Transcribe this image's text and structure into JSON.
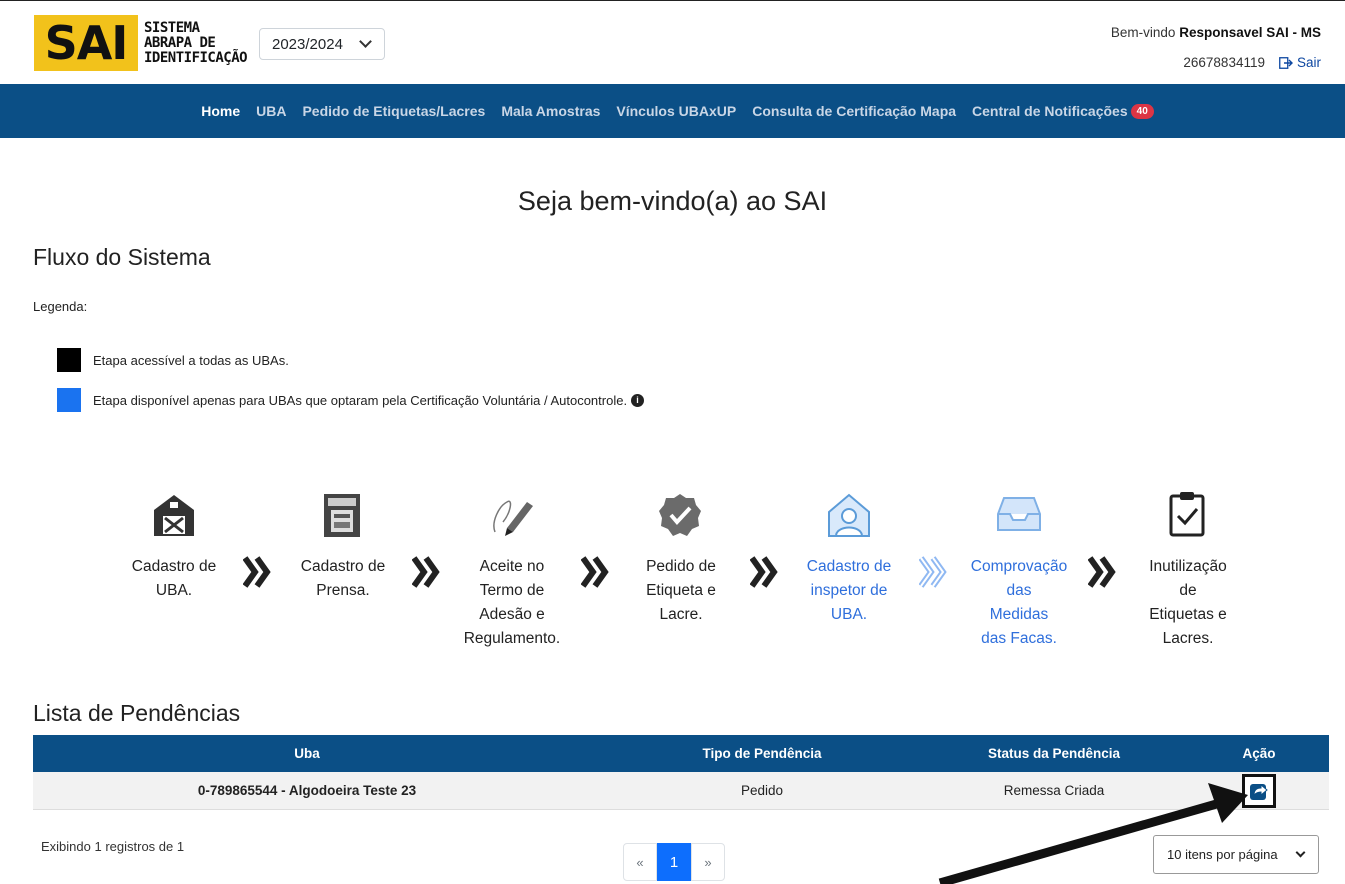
{
  "header": {
    "logo_text": "SAI",
    "logo_sub": [
      "SISTEMA",
      "ABRAPA DE",
      "IDENTIFICAÇÃO"
    ],
    "season": "2023/2024",
    "welcome_prefix": "Bem-vindo",
    "user_name": "Responsavel SAI - MS",
    "user_id": "26678834119",
    "logout_label": "Sair"
  },
  "nav": {
    "items": [
      {
        "label": "Home",
        "active": true
      },
      {
        "label": "UBA"
      },
      {
        "label": "Pedido de Etiquetas/Lacres"
      },
      {
        "label": "Mala Amostras"
      },
      {
        "label": "Vínculos UBAxUP"
      },
      {
        "label": "Consulta de Certificação Mapa"
      },
      {
        "label": "Central de Notificações"
      }
    ],
    "notification_count": "40"
  },
  "main": {
    "title": "Seja bem-vindo(a) ao SAI",
    "flow_title": "Fluxo do Sistema",
    "legend_label": "Legenda:",
    "legend_black": "Etapa acessível a todas as UBAs.",
    "legend_blue": "Etapa disponível apenas para UBAs que optaram pela Certificação Voluntária / Autocontrole.",
    "colors": {
      "black": "#000000",
      "blue": "#1a73f0",
      "nav": "#0b4f86"
    }
  },
  "flow": {
    "steps": [
      {
        "lines": [
          "Cadastro de",
          "UBA."
        ],
        "icon": "barn-icon"
      },
      {
        "lines": [
          "Cadastro de",
          "Prensa."
        ],
        "icon": "press-icon"
      },
      {
        "lines": [
          "Aceite no",
          "Termo de",
          "Adesão e",
          "Regulamento."
        ],
        "icon": "signature-icon"
      },
      {
        "lines": [
          "Pedido de",
          "Etiqueta e",
          "Lacre."
        ],
        "icon": "badge-check-icon"
      },
      {
        "lines": [
          "Cadastro de",
          "inspetor de",
          "UBA."
        ],
        "icon": "inspector-icon"
      },
      {
        "lines": [
          "Comprovação",
          "das",
          "Medidas",
          "das Facas."
        ],
        "icon": "tray-icon"
      },
      {
        "lines": [
          "Inutilização",
          "de",
          "Etiquetas e",
          "Lacres."
        ],
        "icon": "clipboard-check-icon"
      }
    ]
  },
  "pendencias": {
    "title": "Lista de Pendências",
    "columns": [
      "Uba",
      "Tipo de Pendência",
      "Status da Pendência",
      "Ação"
    ],
    "rows": [
      {
        "uba": "0-789865544 - Algodoeira Teste 23",
        "tipo": "Pedido",
        "status": "Remessa Criada"
      }
    ],
    "records_text": "Exibindo 1 registros de 1",
    "pager": {
      "prev": "«",
      "current": "1",
      "next": "»"
    },
    "per_page": "10 itens por página"
  }
}
